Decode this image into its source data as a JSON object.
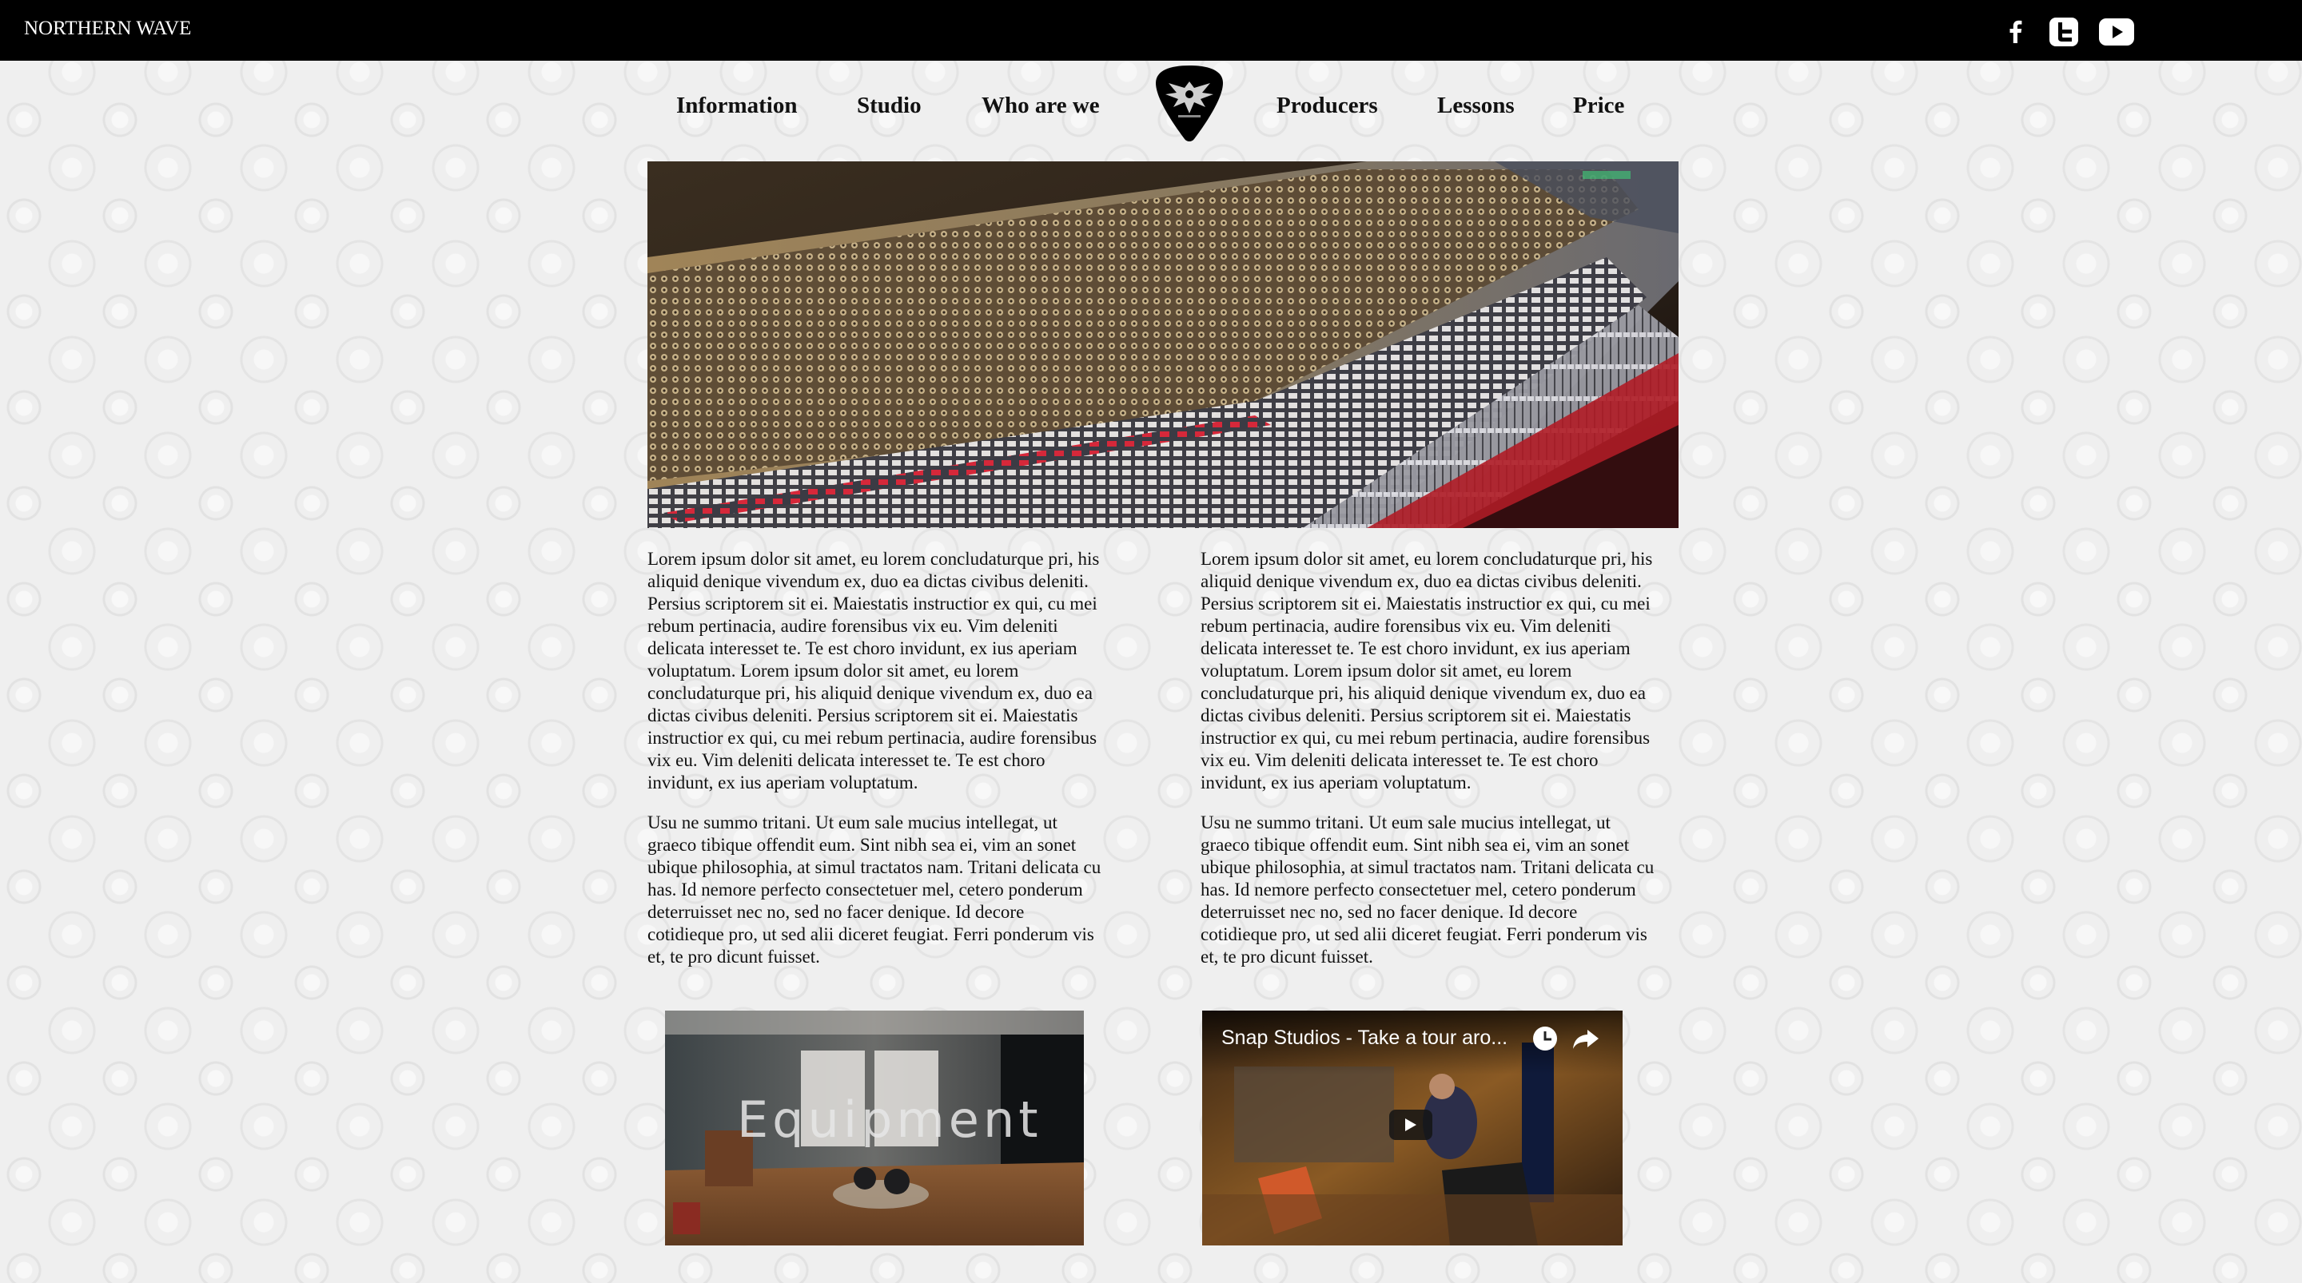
{
  "topbar": {
    "brand": "NORTHERN WAVE",
    "social": [
      {
        "icon": "facebook-icon"
      },
      {
        "icon": "twitter-icon"
      },
      {
        "icon": "youtube-icon"
      }
    ]
  },
  "nav": {
    "items_left": [
      "Information",
      "Studio",
      "Who are we"
    ],
    "items_right": [
      "Producers",
      "Lessons",
      "Price"
    ],
    "logo_icon": "guitar-pick-eagle-logo"
  },
  "hero": {
    "icon": "mixing-console-photo"
  },
  "columns": {
    "left": {
      "p1": "Lorem ipsum dolor sit amet, eu lorem concludaturque pri, his aliquid denique vivendum ex, duo ea dictas civibus deleniti. Persius scriptorem sit ei. Maiestatis instructior ex qui, cu mei rebum pertinacia, audire forensibus vix eu. Vim deleniti delicata interesset te. Te est choro invidunt, ex ius aperiam voluptatum. Lorem ipsum dolor sit amet, eu lorem concludaturque pri, his aliquid denique vivendum ex, duo ea dictas civibus deleniti. Persius scriptorem sit ei. Maiestatis instructior ex qui, cu mei rebum pertinacia, audire forensibus vix eu. Vim deleniti delicata interesset te. Te est choro invidunt, ex ius aperiam voluptatum.",
      "p2": "Usu ne summo tritani. Ut eum sale mucius intellegat, ut graeco tibique offendit eum. Sint nibh sea ei, vim an sonet ubique philosophia, at simul tractatos nam. Tritani delicata cu has. Id nemore perfecto consectetuer mel, cetero ponderum deterruisset nec no, sed no facer denique. Id decore cotidieque pro, ut sed alii diceret feugiat. Ferri ponderum vis et, te pro dicunt fuisset."
    },
    "right": {
      "p1": "Lorem ipsum dolor sit amet, eu lorem concludaturque pri, his aliquid denique vivendum ex, duo ea dictas civibus deleniti. Persius scriptorem sit ei. Maiestatis instructior ex qui, cu mei rebum pertinacia, audire forensibus vix eu. Vim deleniti delicata interesset te. Te est choro invidunt, ex ius aperiam voluptatum. Lorem ipsum dolor sit amet, eu lorem concludaturque pri, his aliquid denique vivendum ex, duo ea dictas civibus deleniti. Persius scriptorem sit ei. Maiestatis instructior ex qui, cu mei rebum pertinacia, audire forensibus vix eu. Vim deleniti delicata interesset te. Te est choro invidunt, ex ius aperiam voluptatum.",
      "p2": "Usu ne summo tritani. Ut eum sale mucius intellegat, ut graeco tibique offendit eum. Sint nibh sea ei, vim an sonet ubique philosophia, at simul tractatos nam. Tritani delicata cu has. Id nemore perfecto consectetuer mel, cetero ponderum deterruisset nec no, sed no facer denique. Id decore cotidieque pro, ut sed alii diceret feugiat. Ferri ponderum vis et, te pro dicunt fuisset."
    }
  },
  "videos": {
    "equipment": {
      "title": "Equipment",
      "icon": "studio-room-photo"
    },
    "tour": {
      "title": "Snap Studios - Take a tour aro...",
      "icons": [
        "clock-icon",
        "share-icon",
        "play-icon"
      ]
    }
  },
  "colors": {
    "topbar": "#000000",
    "background": "#efefef",
    "text": "#111111"
  }
}
